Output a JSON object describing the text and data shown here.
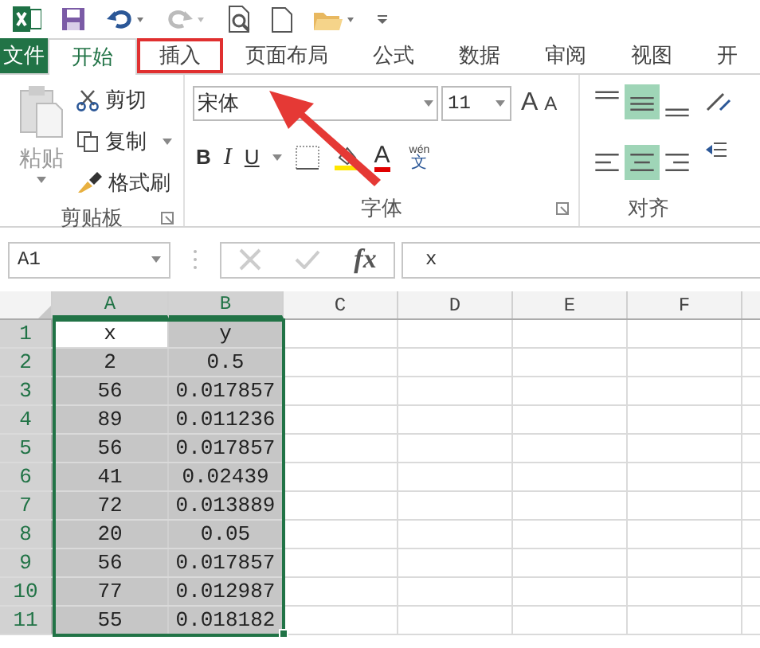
{
  "quick_access": {
    "redo": {
      "disabled": true
    }
  },
  "tabs": [
    {
      "label": "文件",
      "kind": "file",
      "selected": false,
      "boxed": false
    },
    {
      "label": "开始",
      "kind": "tab",
      "selected": true,
      "boxed": false
    },
    {
      "label": "插入",
      "kind": "tab",
      "selected": false,
      "boxed": true
    },
    {
      "label": "页面布局",
      "kind": "tab",
      "selected": false,
      "boxed": false
    },
    {
      "label": "公式",
      "kind": "tab",
      "selected": false,
      "boxed": false
    },
    {
      "label": "数据",
      "kind": "tab",
      "selected": false,
      "boxed": false
    },
    {
      "label": "审阅",
      "kind": "tab",
      "selected": false,
      "boxed": false
    },
    {
      "label": "视图",
      "kind": "tab",
      "selected": false,
      "boxed": false
    },
    {
      "label": "开",
      "kind": "tab",
      "selected": false,
      "boxed": false
    }
  ],
  "ribbon": {
    "clipboard": {
      "label": "剪贴板",
      "paste": "粘贴",
      "cut": "剪切",
      "copy": "复制",
      "format_painter": "格式刷"
    },
    "font": {
      "label": "字体",
      "font_name": "宋体",
      "font_size": "11",
      "grow_font": "A",
      "shrink_font": "A",
      "bold": "B",
      "italic": "I",
      "underline": "U",
      "font_color": "A",
      "phonetic": [
        "wén",
        "文"
      ]
    },
    "alignment": {
      "label": "对齐",
      "buttons": [
        {
          "kind": "top",
          "selected": false
        },
        {
          "kind": "middle",
          "selected": true
        },
        {
          "kind": "bottom",
          "selected": false
        },
        {
          "kind": "left",
          "selected": false
        },
        {
          "kind": "center",
          "selected": true
        },
        {
          "kind": "right",
          "selected": false
        }
      ]
    }
  },
  "formula_bar": {
    "name_box": "A1",
    "function_label": "fx",
    "formula": "x"
  },
  "sheet": {
    "columns": [
      {
        "label": "A",
        "selected": true
      },
      {
        "label": "B",
        "selected": true
      },
      {
        "label": "C",
        "selected": false
      },
      {
        "label": "D",
        "selected": false
      },
      {
        "label": "E",
        "selected": false
      },
      {
        "label": "F",
        "selected": false
      }
    ],
    "rows": [
      {
        "number": "1",
        "selected": true,
        "cells": [
          {
            "text": "x",
            "active": true
          },
          {
            "text": "y",
            "active": false
          }
        ]
      },
      {
        "number": "2",
        "selected": true,
        "cells": [
          {
            "text": "2",
            "active": false
          },
          {
            "text": "0.5",
            "active": false
          }
        ]
      },
      {
        "number": "3",
        "selected": true,
        "cells": [
          {
            "text": "56",
            "active": false
          },
          {
            "text": "0.017857",
            "active": false
          }
        ]
      },
      {
        "number": "4",
        "selected": true,
        "cells": [
          {
            "text": "89",
            "active": false
          },
          {
            "text": "0.011236",
            "active": false
          }
        ]
      },
      {
        "number": "5",
        "selected": true,
        "cells": [
          {
            "text": "56",
            "active": false
          },
          {
            "text": "0.017857",
            "active": false
          }
        ]
      },
      {
        "number": "6",
        "selected": true,
        "cells": [
          {
            "text": "41",
            "active": false
          },
          {
            "text": "0.02439",
            "active": false
          }
        ]
      },
      {
        "number": "7",
        "selected": true,
        "cells": [
          {
            "text": "72",
            "active": false
          },
          {
            "text": "0.013889",
            "active": false
          }
        ]
      },
      {
        "number": "8",
        "selected": true,
        "cells": [
          {
            "text": "20",
            "active": false
          },
          {
            "text": "0.05",
            "active": false
          }
        ]
      },
      {
        "number": "9",
        "selected": true,
        "cells": [
          {
            "text": "56",
            "active": false
          },
          {
            "text": "0.017857",
            "active": false
          }
        ]
      },
      {
        "number": "10",
        "selected": true,
        "cells": [
          {
            "text": "77",
            "active": false
          },
          {
            "text": "0.012987",
            "active": false
          }
        ]
      },
      {
        "number": "11",
        "selected": true,
        "cells": [
          {
            "text": "55",
            "active": false
          },
          {
            "text": "0.018182",
            "active": false
          }
        ]
      }
    ]
  }
}
